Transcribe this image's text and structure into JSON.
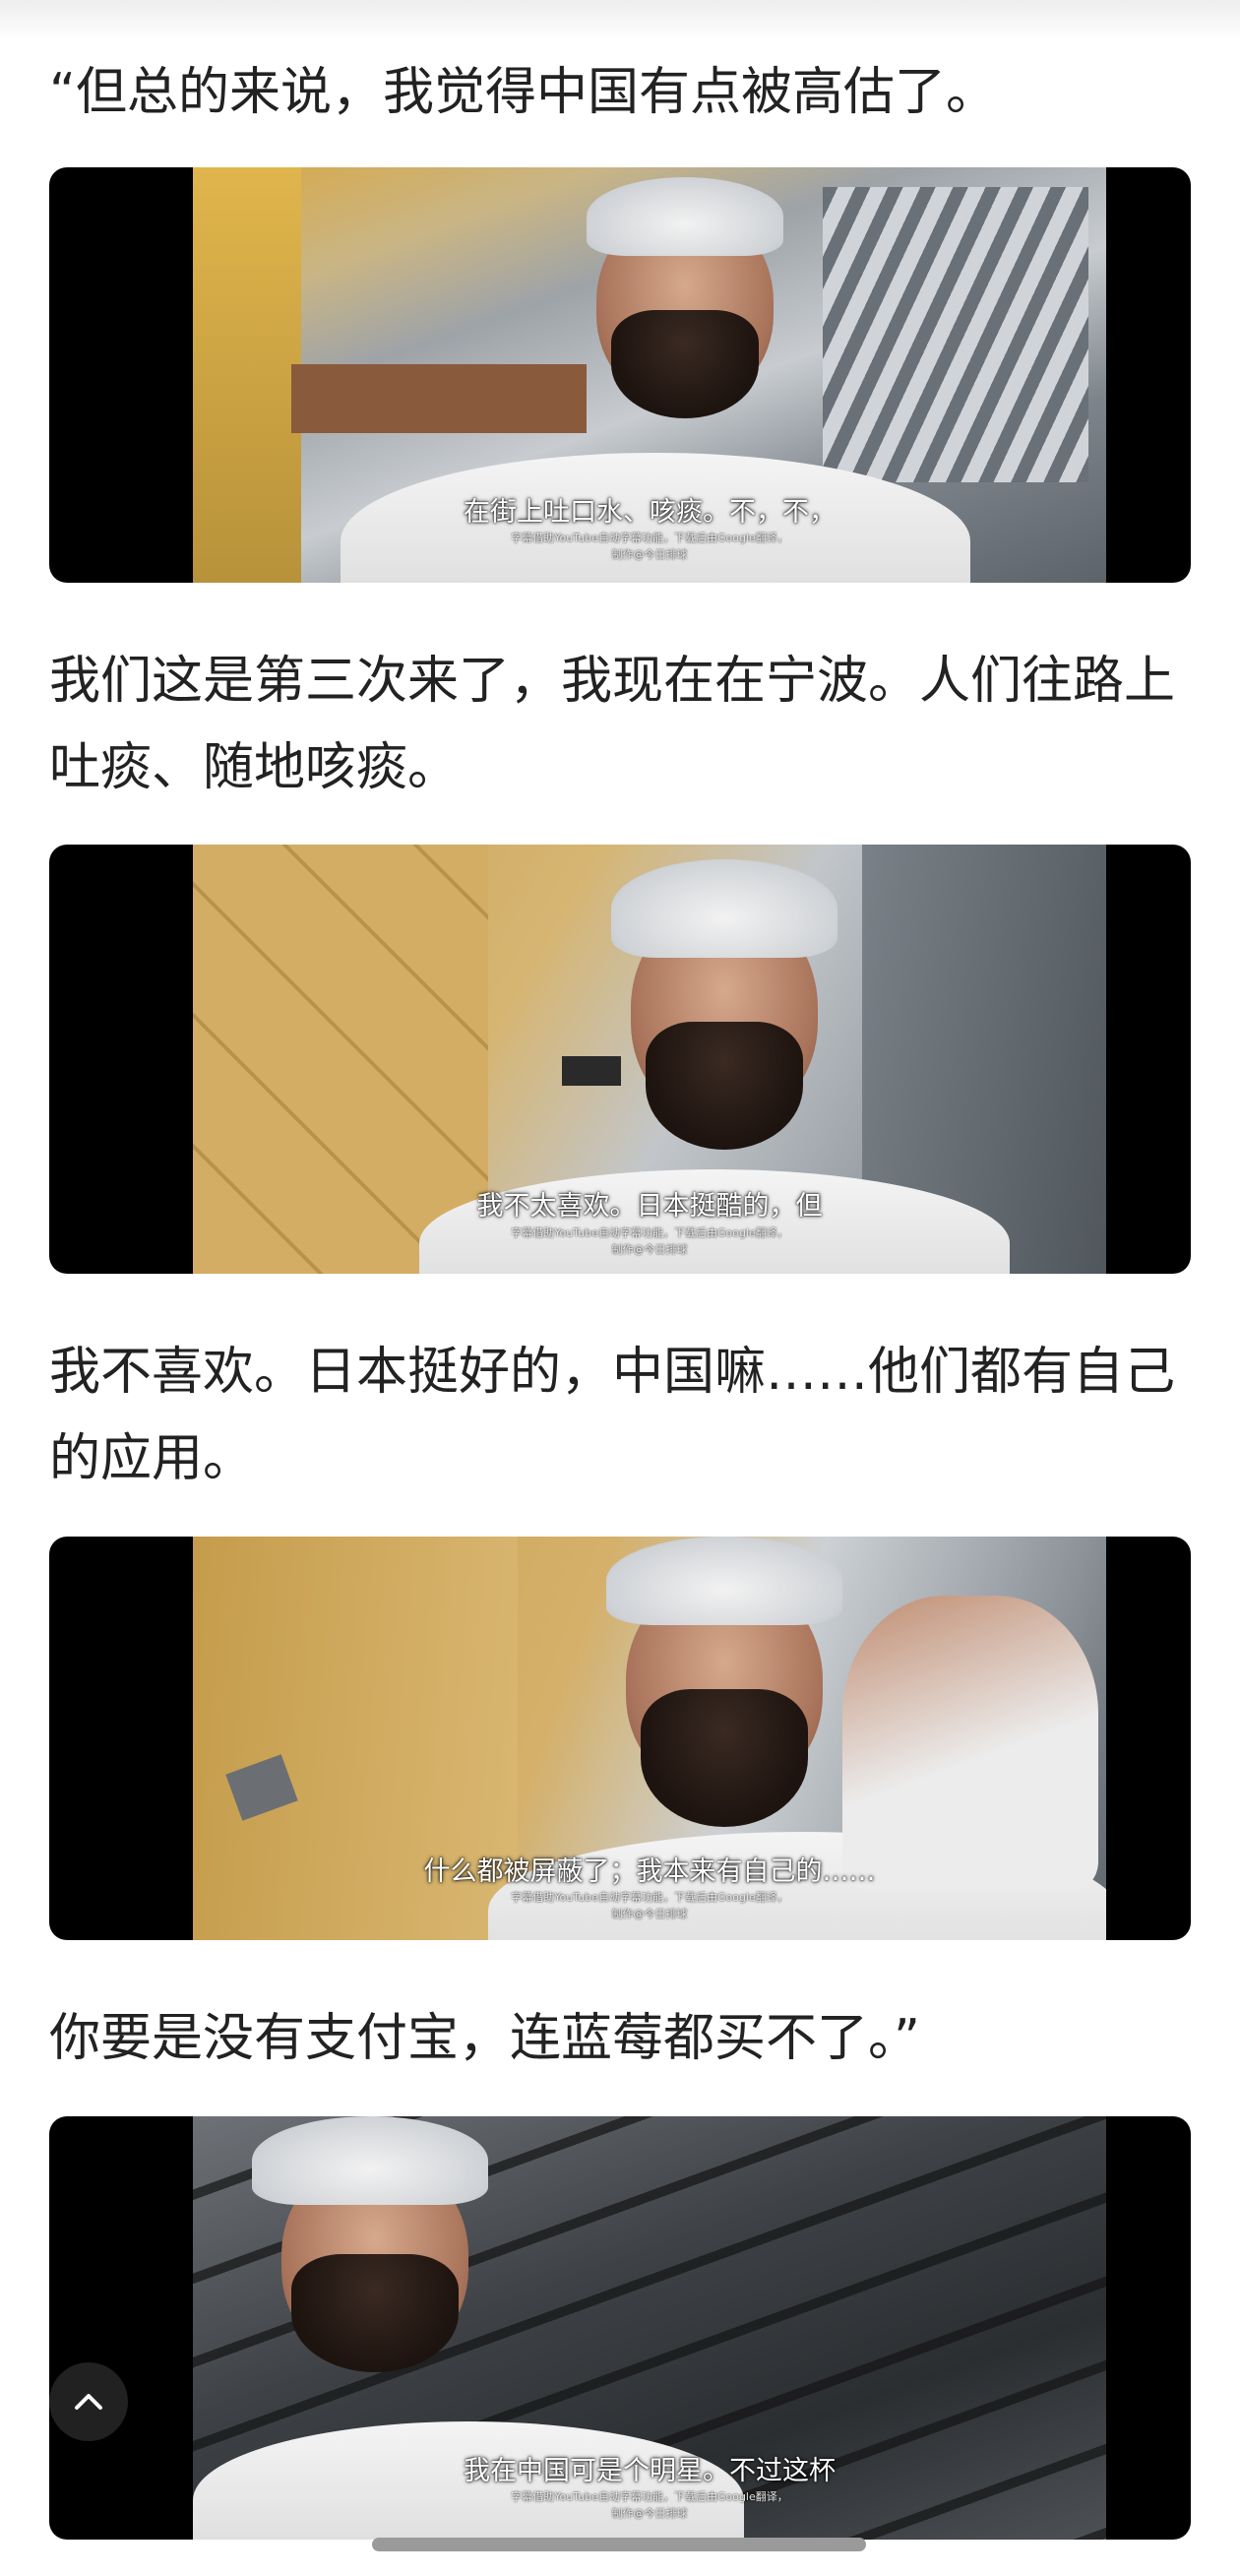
{
  "article": {
    "paragraphs": [
      "“但总的来说，我觉得中国有点被高估了。",
      "我们这是第三次来了，我现在在宁波。人们往路上吐痰、随地咳痰。",
      "我不喜欢。日本挺好的，中国嘛……他们都有自己的应用。",
      "你要是没有支付宝，连蓝莓都买不了。”"
    ],
    "video_frames": [
      {
        "subtitle": "在街上吐口水、咳痰。不，不，",
        "credit_line1": "字幕借助YouTube自动字幕功能，下载后由Google翻译，",
        "credit_line2": "制作@今日排球"
      },
      {
        "subtitle": "我不太喜欢。日本挺酷的，但",
        "credit_line1": "字幕借助YouTube自动字幕功能，下载后由Google翻译，",
        "credit_line2": "制作@今日排球"
      },
      {
        "subtitle": "什么都被屏蔽了；我本来有自己的……",
        "credit_line1": "字幕借助YouTube自动字幕功能，下载后由Google翻译，",
        "credit_line2": "制作@今日排球"
      },
      {
        "subtitle": "我在中国可是个明星。不过这杯",
        "credit_line1": "字幕借助YouTube自动字幕功能，下载后由Google翻译，",
        "credit_line2": "制作@今日排球"
      }
    ]
  },
  "controls": {
    "scroll_top_icon": "chevron-up-icon"
  },
  "colors": {
    "text": "#222222",
    "letterbox": "#000000",
    "subtitle": "#ffffff"
  }
}
